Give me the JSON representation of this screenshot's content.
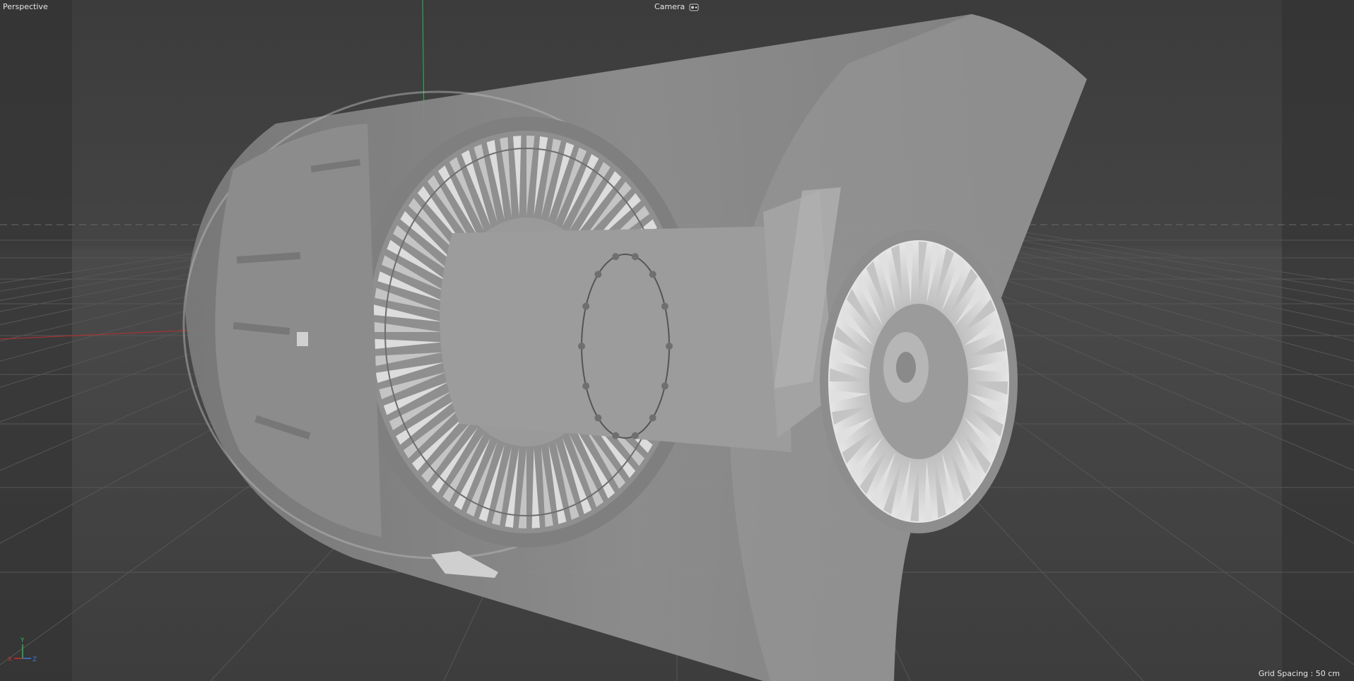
{
  "viewport": {
    "view_name": "Perspective",
    "camera_label": "Camera",
    "grid_spacing_text": "Grid Spacing : 50 cm",
    "axis": {
      "x": "X",
      "y": "Y",
      "z": "Z"
    }
  },
  "colors": {
    "background": "#3a3a3a",
    "safe_frame_side": "#2e2e2e",
    "grid_line": "#555555",
    "axis_x": "#c8302f",
    "axis_y": "#2fb552",
    "axis_z": "#3a7bd5",
    "nacelle": "#8a8a8a",
    "engine_metal": "#a8a8a8",
    "blade_light": "#d9d9d9"
  },
  "icons": {
    "camera": "camera-icon"
  }
}
